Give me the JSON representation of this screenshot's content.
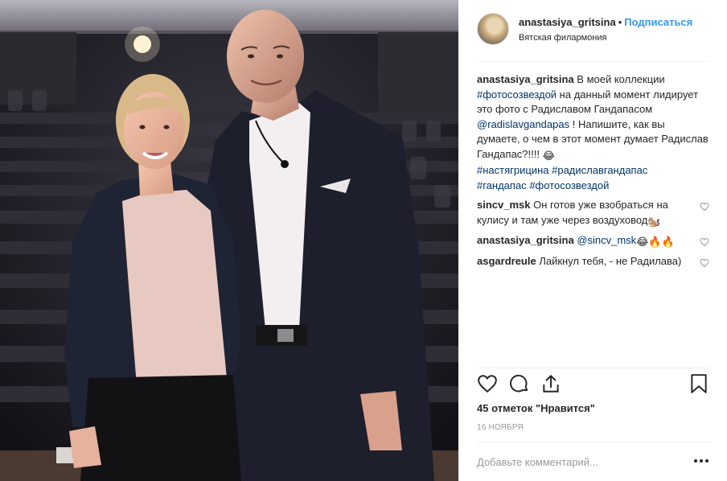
{
  "post": {
    "username": "anastasiya_gritsina",
    "separator": "•",
    "follow_label": "Подписаться",
    "location": "Вятская филармония"
  },
  "caption": {
    "user": "anastasiya_gritsina",
    "t1": " В моей коллекции ",
    "tag1": "#фотосозвездой",
    "t2": " на данный момент лидирует это фото с Радиславом Гандапасом ",
    "mention": "@radislavgandapas",
    "t3": " ! Напишите, как вы думаете, о чем в этот момент думает Радислав Гандапас?!!!! ",
    "emoji": "😂",
    "tag2": "#настягрицина",
    "tag3": "#радиславгандапас",
    "tag4": "#гандапас",
    "tag5": "#фотосозвездой"
  },
  "comments": [
    {
      "user": "sincv_msk",
      "text": " Он готов уже взобраться на кулису и там уже через воздуховод",
      "emoji": "🐿️"
    },
    {
      "user": "anastasiya_gritsina",
      "mention": "@sincv_msk",
      "emoji": " 😂🔥🔥"
    },
    {
      "user": "asgardreule",
      "text": " Лайкнул тебя, - не Радилава)"
    }
  ],
  "icons": {
    "like": "heart-icon",
    "comment": "comment-bubble-icon",
    "share": "share-icon",
    "save": "bookmark-icon",
    "comment_like": "heart-outline-icon",
    "more": "ellipsis-icon"
  },
  "likes_text": "45 отметок \"Нравится\"",
  "date": "16 ноября",
  "add_comment_placeholder": "Добавьте комментарий...",
  "colors": {
    "link": "#3897f0",
    "tag": "#003569",
    "muted": "#999999",
    "divider": "#efefef"
  }
}
